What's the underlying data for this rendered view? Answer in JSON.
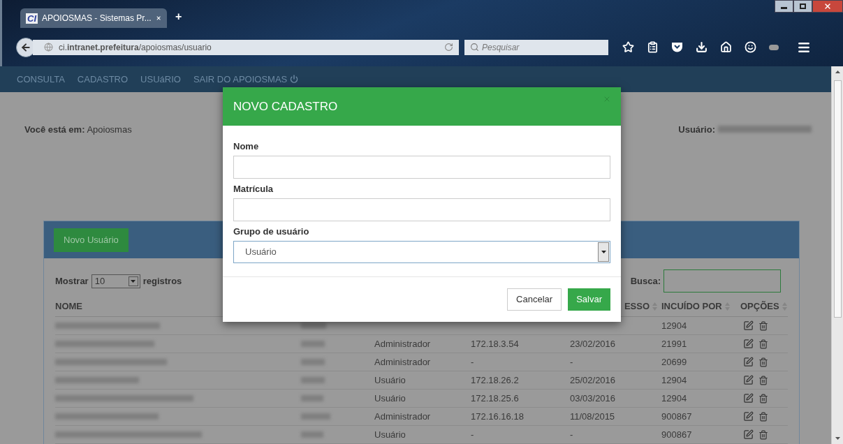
{
  "browser": {
    "tab_title": "APOIOSMAS - Sistemas Pr...",
    "tab_logo": "CI",
    "new_tab": "+",
    "url": "ci.**intranet.prefeitura**/apoiosmas/usuario",
    "search_placeholder": "Pesquisar"
  },
  "nav": {
    "items": [
      {
        "label": "CONSULTA",
        "kind": "link"
      },
      {
        "label": "CADASTRO",
        "kind": "link"
      },
      {
        "label": "USUáRIO",
        "kind": "link"
      },
      {
        "label": "SAIR DO APOIOSMAS",
        "kind": "logout"
      }
    ]
  },
  "page": {
    "breadcrumb_label": "Você está em:",
    "breadcrumb_value": "Apoiosmas",
    "user_label": "Usuário:"
  },
  "panel": {
    "new_button": "Novo Usuário",
    "show_label": "Mostrar",
    "page_size": "10",
    "records_label": "registros",
    "search_label": "Busca:"
  },
  "table": {
    "columns": [
      {
        "label": "NOME",
        "kind": "name",
        "sortable": false
      },
      {
        "label": "ESSO",
        "kind": "last_access",
        "sortable": true
      },
      {
        "label": "INCUÍDO POR",
        "kind": "included_by",
        "sortable": true
      },
      {
        "label": "OPÇÕES",
        "kind": "options",
        "sortable": true
      }
    ],
    "rows": [
      {
        "included_by": "12904"
      },
      {
        "group": "Administrador",
        "ip": "172.18.3.54",
        "last_access": "23/02/2016",
        "included_by": "21991"
      },
      {
        "group": "Administrador",
        "ip": "-",
        "last_access": "-",
        "included_by": "20699"
      },
      {
        "group": "Usuário",
        "ip": "172.18.26.2",
        "last_access": "25/02/2016",
        "included_by": "12904"
      },
      {
        "group": "Usuário",
        "ip": "172.18.25.6",
        "last_access": "03/03/2016",
        "included_by": "12904"
      },
      {
        "group": "Administrador",
        "ip": "172.16.16.18",
        "last_access": "11/08/2015",
        "included_by": "900867"
      },
      {
        "group": "Usuário",
        "ip": "-",
        "last_access": "-",
        "included_by": "900867"
      }
    ]
  },
  "modal": {
    "title": "NOVO CADASTRO",
    "fields": [
      {
        "label": "Nome",
        "kind": "text"
      },
      {
        "label": "Matrícula",
        "kind": "text"
      },
      {
        "label": "Grupo de usuário",
        "kind": "select",
        "value": "Usuário"
      }
    ],
    "buttons": [
      {
        "label": "Cancelar",
        "kind": "secondary"
      },
      {
        "label": "Salvar",
        "kind": "primary"
      }
    ]
  }
}
